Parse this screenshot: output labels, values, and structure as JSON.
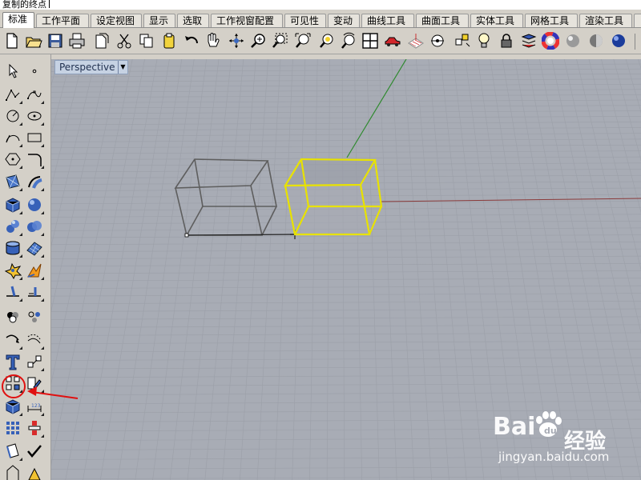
{
  "command_prompt": {
    "text": "复制的终点"
  },
  "tabs": [
    {
      "label": "标准",
      "active": true
    },
    {
      "label": "工作平面",
      "active": false
    },
    {
      "label": "设定视图",
      "active": false
    },
    {
      "label": "显示",
      "active": false
    },
    {
      "label": "选取",
      "active": false
    },
    {
      "label": "工作视窗配置",
      "active": false
    },
    {
      "label": "可见性",
      "active": false
    },
    {
      "label": "变动",
      "active": false
    },
    {
      "label": "曲线工具",
      "active": false
    },
    {
      "label": "曲面工具",
      "active": false
    },
    {
      "label": "实体工具",
      "active": false
    },
    {
      "label": "网格工具",
      "active": false
    },
    {
      "label": "渲染工具",
      "active": false
    }
  ],
  "toolbar_icons": [
    "new-file-icon",
    "open-folder-icon",
    "save-icon",
    "print-icon",
    "import-icon",
    "cut-icon",
    "copy-icon",
    "paste-icon",
    "undo-icon",
    "pan-hand-icon",
    "rotate-view-icon",
    "zoom-icon",
    "zoom-window-icon",
    "zoom-extents-icon",
    "zoom-selected-icon",
    "rotate-camera-icon",
    "four-viewports-icon",
    "car-icon",
    "construction-plane-icon",
    "point-icon",
    "grid-snap-icon",
    "light-bulb-icon",
    "lock-icon",
    "layer-icon",
    "color-wheel-icon",
    "render-sphere-icon",
    "material-sphere-icon",
    "blue-sphere-icon"
  ],
  "left_tools": [
    "select-arrow-icon",
    "point-icon",
    "polyline-icon",
    "curve-points-icon",
    "circle-icon",
    "ellipse-icon",
    "arc-icon",
    "rectangle-icon",
    "polygon-icon",
    "fillet-curve-icon",
    "surface-corner-icon",
    "extrude-curve-icon",
    "box-solid-icon",
    "sphere-icon",
    "sphere-group-icon",
    "boolean-icon",
    "cylinder-icon",
    "surface-patch-icon",
    "explode-icon",
    "burst-icon",
    "trim-icon",
    "split-icon",
    "group-icon",
    "ungroup-icon",
    "curve-drag-icon",
    "curve-offset-icon",
    "text-icon",
    "block-icon",
    "array-icon",
    "copy-edit-icon",
    "box-edit-icon",
    "dimension-icon",
    "grid-array-icon",
    "analysis-icon",
    "properties-icon",
    "check-icon",
    "render-icon",
    "shade-icon"
  ],
  "viewport": {
    "label": "Perspective",
    "grid_color": "#9ea2ab",
    "background": "#a8acb5",
    "x_axis_color": "#8a3a3a",
    "y_axis_color": "#2f8a2f",
    "selected_color": "#e8e200"
  },
  "watermark": {
    "logo": "Bai",
    "logo_tail": "经验",
    "url": "jingyan.baidu.com"
  },
  "annotation": {
    "highlight_tool": "array-icon",
    "color": "#e01010"
  }
}
